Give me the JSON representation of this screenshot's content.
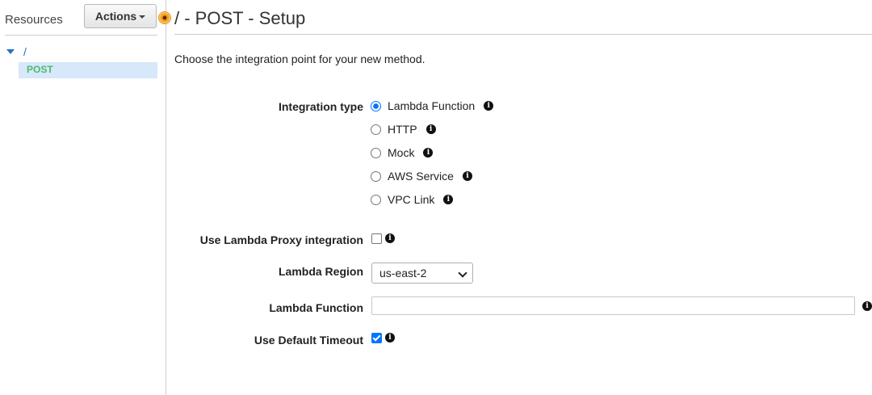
{
  "sidebar": {
    "title": "Resources",
    "actions_label": "Actions",
    "tree_root": "/",
    "tree_child": "POST"
  },
  "header": {
    "title": "/ - POST - Setup"
  },
  "intro": "Choose the integration point for your new method.",
  "integration": {
    "label": "Integration type",
    "selected": "Lambda Function",
    "options": [
      {
        "label": "Lambda Function",
        "checked": true
      },
      {
        "label": "HTTP",
        "checked": false
      },
      {
        "label": "Mock",
        "checked": false
      },
      {
        "label": "AWS Service",
        "checked": false
      },
      {
        "label": "VPC Link",
        "checked": false
      }
    ]
  },
  "proxy": {
    "label": "Use Lambda Proxy integration",
    "checked": false
  },
  "region": {
    "label": "Lambda Region",
    "value": "us-east-2"
  },
  "function": {
    "label": "Lambda Function",
    "value": "",
    "placeholder": ""
  },
  "timeout": {
    "label": "Use Default Timeout",
    "checked": true
  },
  "colors": {
    "accent": "#2670c5",
    "post_green": "#4cbb6d",
    "selected_bg": "#d6e8fa",
    "checkbox_blue": "#0075ff"
  },
  "icons": {
    "info": "info-circle-icon",
    "tree_toggle": "caret-down-icon",
    "resize": "resize-handle-icon",
    "dropdown": "chevron-down-icon"
  }
}
